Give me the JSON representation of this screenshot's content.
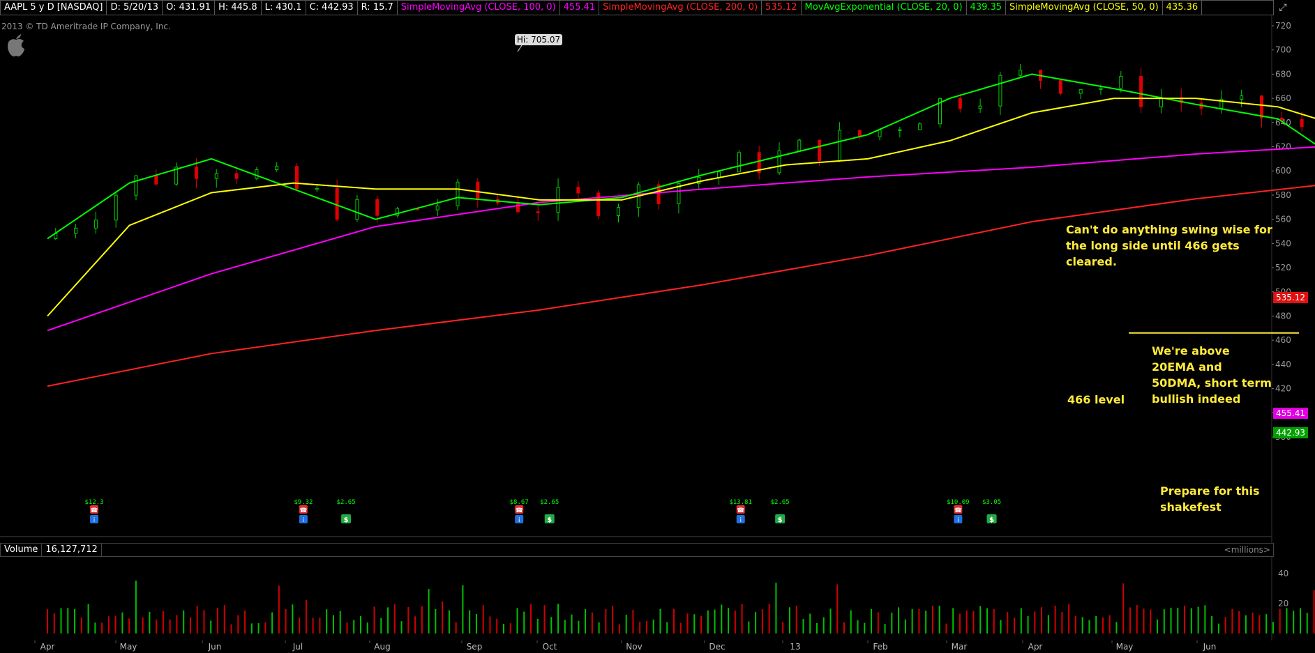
{
  "header": {
    "symbol": "AAPL 5 y D [NASDAQ]",
    "date": "D: 5/20/13",
    "open": "O: 431.91",
    "high": "H: 445.8",
    "low": "L: 430.1",
    "close": "C: 442.93",
    "range": "R: 15.7",
    "studies": [
      {
        "label": "SimpleMovingAvg (CLOSE, 100, 0)",
        "value": "455.41",
        "color": "#ff00ff"
      },
      {
        "label": "SimpleMovingAvg (CLOSE, 200, 0)",
        "value": "535.12",
        "color": "#ff2222"
      },
      {
        "label": "MovAvgExponential (CLOSE, 20, 0)",
        "value": "439.35",
        "color": "#00ff00"
      },
      {
        "label": "SimpleMovingAvg (CLOSE, 50, 0)",
        "value": "435.36",
        "color": "#ffff00"
      }
    ]
  },
  "window_icon": "expand-icon",
  "copyright": "2013 © TD Ameritrade IP Company, Inc.",
  "hi_marker": "Hi: 705.07",
  "price_axis": [
    "720",
    "700",
    "680",
    "660",
    "640",
    "620",
    "600",
    "580",
    "560",
    "540",
    "520",
    "500",
    "480",
    "460",
    "440",
    "420",
    "400",
    "380"
  ],
  "price_tags": [
    {
      "value": "535.12",
      "color": "#e01010"
    },
    {
      "value": "455.41",
      "color": "#e000e0"
    },
    {
      "value": "442.93",
      "color": "#00a000"
    }
  ],
  "volume_header": {
    "label": "Volume",
    "value": "16,127,712",
    "units": "<millions>"
  },
  "volume_axis": [
    "40",
    "20"
  ],
  "months": [
    "Apr",
    "May",
    "Jun",
    "Jul",
    "Aug",
    "Sep",
    "Oct",
    "Nov",
    "Dec",
    "13",
    "Feb",
    "Mar",
    "Apr",
    "May",
    "Jun"
  ],
  "events": [
    {
      "label": "$12.3",
      "type": "earnings"
    },
    {
      "label": "$9.32",
      "type": "earnings"
    },
    {
      "label": "$2.65",
      "type": "dividend"
    },
    {
      "label": "$8.67",
      "type": "earnings"
    },
    {
      "label": "$2.65",
      "type": "dividend"
    },
    {
      "label": "$13.81",
      "type": "earnings"
    },
    {
      "label": "$2.65",
      "type": "dividend"
    },
    {
      "label": "$10.09",
      "type": "earnings"
    },
    {
      "label": "$3.05",
      "type": "dividend"
    }
  ],
  "annotations": {
    "swing": "Can't do anything swing wise for the long side until 466 gets cleared.",
    "bullish": "We're above 20EMA and 50DMA, short term bullish indeed",
    "level": "466 level",
    "shakefest": "Prepare for this shakefest"
  },
  "chart_data": {
    "type": "candlestick",
    "symbol": "AAPL",
    "timeframe": "5 y D",
    "ylim": [
      373,
      730
    ],
    "x": [
      "Apr",
      "May",
      "Jun",
      "Jul",
      "Aug",
      "Sep",
      "Oct",
      "Nov",
      "Dec",
      "13",
      "Feb",
      "Mar",
      "Apr",
      "May",
      "Jun"
    ],
    "series": [
      {
        "name": "SimpleMovingAvg (CLOSE, 100, 0)",
        "color": "#ff00ff",
        "values": [
          [
            0,
            468
          ],
          [
            2,
            515
          ],
          [
            4,
            554
          ],
          [
            6,
            574
          ],
          [
            8,
            585
          ],
          [
            10,
            595
          ],
          [
            12,
            603
          ],
          [
            14,
            614
          ],
          [
            16,
            622
          ],
          [
            17,
            627
          ],
          [
            18,
            629
          ],
          [
            19,
            626
          ],
          [
            20,
            621
          ],
          [
            21,
            613
          ],
          [
            22,
            600
          ],
          [
            23,
            583
          ],
          [
            24,
            563
          ],
          [
            25,
            525
          ],
          [
            26,
            497
          ],
          [
            27,
            476
          ],
          [
            28,
            465
          ],
          [
            28.8,
            456
          ]
        ]
      },
      {
        "name": "SimpleMovingAvg (CLOSE, 200, 0)",
        "color": "#ff2222",
        "values": [
          [
            0,
            422
          ],
          [
            2,
            449
          ],
          [
            4,
            468
          ],
          [
            6,
            485
          ],
          [
            8,
            506
          ],
          [
            10,
            530
          ],
          [
            12,
            558
          ],
          [
            14,
            577
          ],
          [
            16,
            592
          ],
          [
            18,
            600
          ],
          [
            19,
            602
          ],
          [
            20,
            601
          ],
          [
            21,
            598
          ],
          [
            22,
            591
          ],
          [
            24,
            575
          ],
          [
            26,
            560
          ],
          [
            28,
            543
          ],
          [
            28.8,
            536
          ]
        ]
      },
      {
        "name": "MovAvgExponential (CLOSE, 20, 0)",
        "color": "#00ff00",
        "values": [
          [
            0,
            544
          ],
          [
            1,
            590
          ],
          [
            2,
            610
          ],
          [
            3,
            585
          ],
          [
            4,
            560
          ],
          [
            5,
            578
          ],
          [
            6,
            572
          ],
          [
            7,
            578
          ],
          [
            8,
            597
          ],
          [
            10,
            630
          ],
          [
            11,
            660
          ],
          [
            12,
            680
          ],
          [
            13,
            668
          ],
          [
            14,
            655
          ],
          [
            15,
            643
          ],
          [
            15.5,
            620
          ],
          [
            16,
            590
          ],
          [
            16.5,
            570
          ],
          [
            17,
            578
          ],
          [
            17.5,
            565
          ],
          [
            18,
            545
          ],
          [
            19,
            530
          ],
          [
            20,
            515
          ],
          [
            21,
            485
          ],
          [
            22,
            470
          ],
          [
            23,
            448
          ],
          [
            24,
            440
          ],
          [
            25,
            448
          ],
          [
            26,
            428
          ],
          [
            26.5,
            420
          ],
          [
            27,
            440
          ],
          [
            28,
            447
          ],
          [
            28.8,
            440
          ]
        ]
      },
      {
        "name": "SimpleMovingAvg (CLOSE, 50, 0)",
        "color": "#ffff00",
        "values": [
          [
            0,
            480
          ],
          [
            1,
            555
          ],
          [
            2,
            582
          ],
          [
            3,
            590
          ],
          [
            4,
            585
          ],
          [
            5,
            585
          ],
          [
            6,
            576
          ],
          [
            7,
            576
          ],
          [
            8,
            592
          ],
          [
            9,
            605
          ],
          [
            10,
            610
          ],
          [
            11,
            625
          ],
          [
            12,
            648
          ],
          [
            13,
            660
          ],
          [
            14,
            660
          ],
          [
            15,
            653
          ],
          [
            16,
            632
          ],
          [
            17,
            610
          ],
          [
            18,
            590
          ],
          [
            19,
            560
          ],
          [
            20,
            535
          ],
          [
            21,
            515
          ],
          [
            22,
            495
          ],
          [
            23,
            480
          ],
          [
            24,
            463
          ],
          [
            25,
            455
          ],
          [
            26,
            447
          ],
          [
            27,
            436
          ],
          [
            28,
            435
          ],
          [
            28.8,
            435
          ]
        ]
      }
    ],
    "volume": {
      "ylim": [
        0,
        50
      ],
      "units": "millions",
      "last": 16.127712
    },
    "reference_line": {
      "value": 466,
      "label": "466 level"
    },
    "high": {
      "value": 705.07,
      "label": "Hi: 705.07"
    }
  }
}
